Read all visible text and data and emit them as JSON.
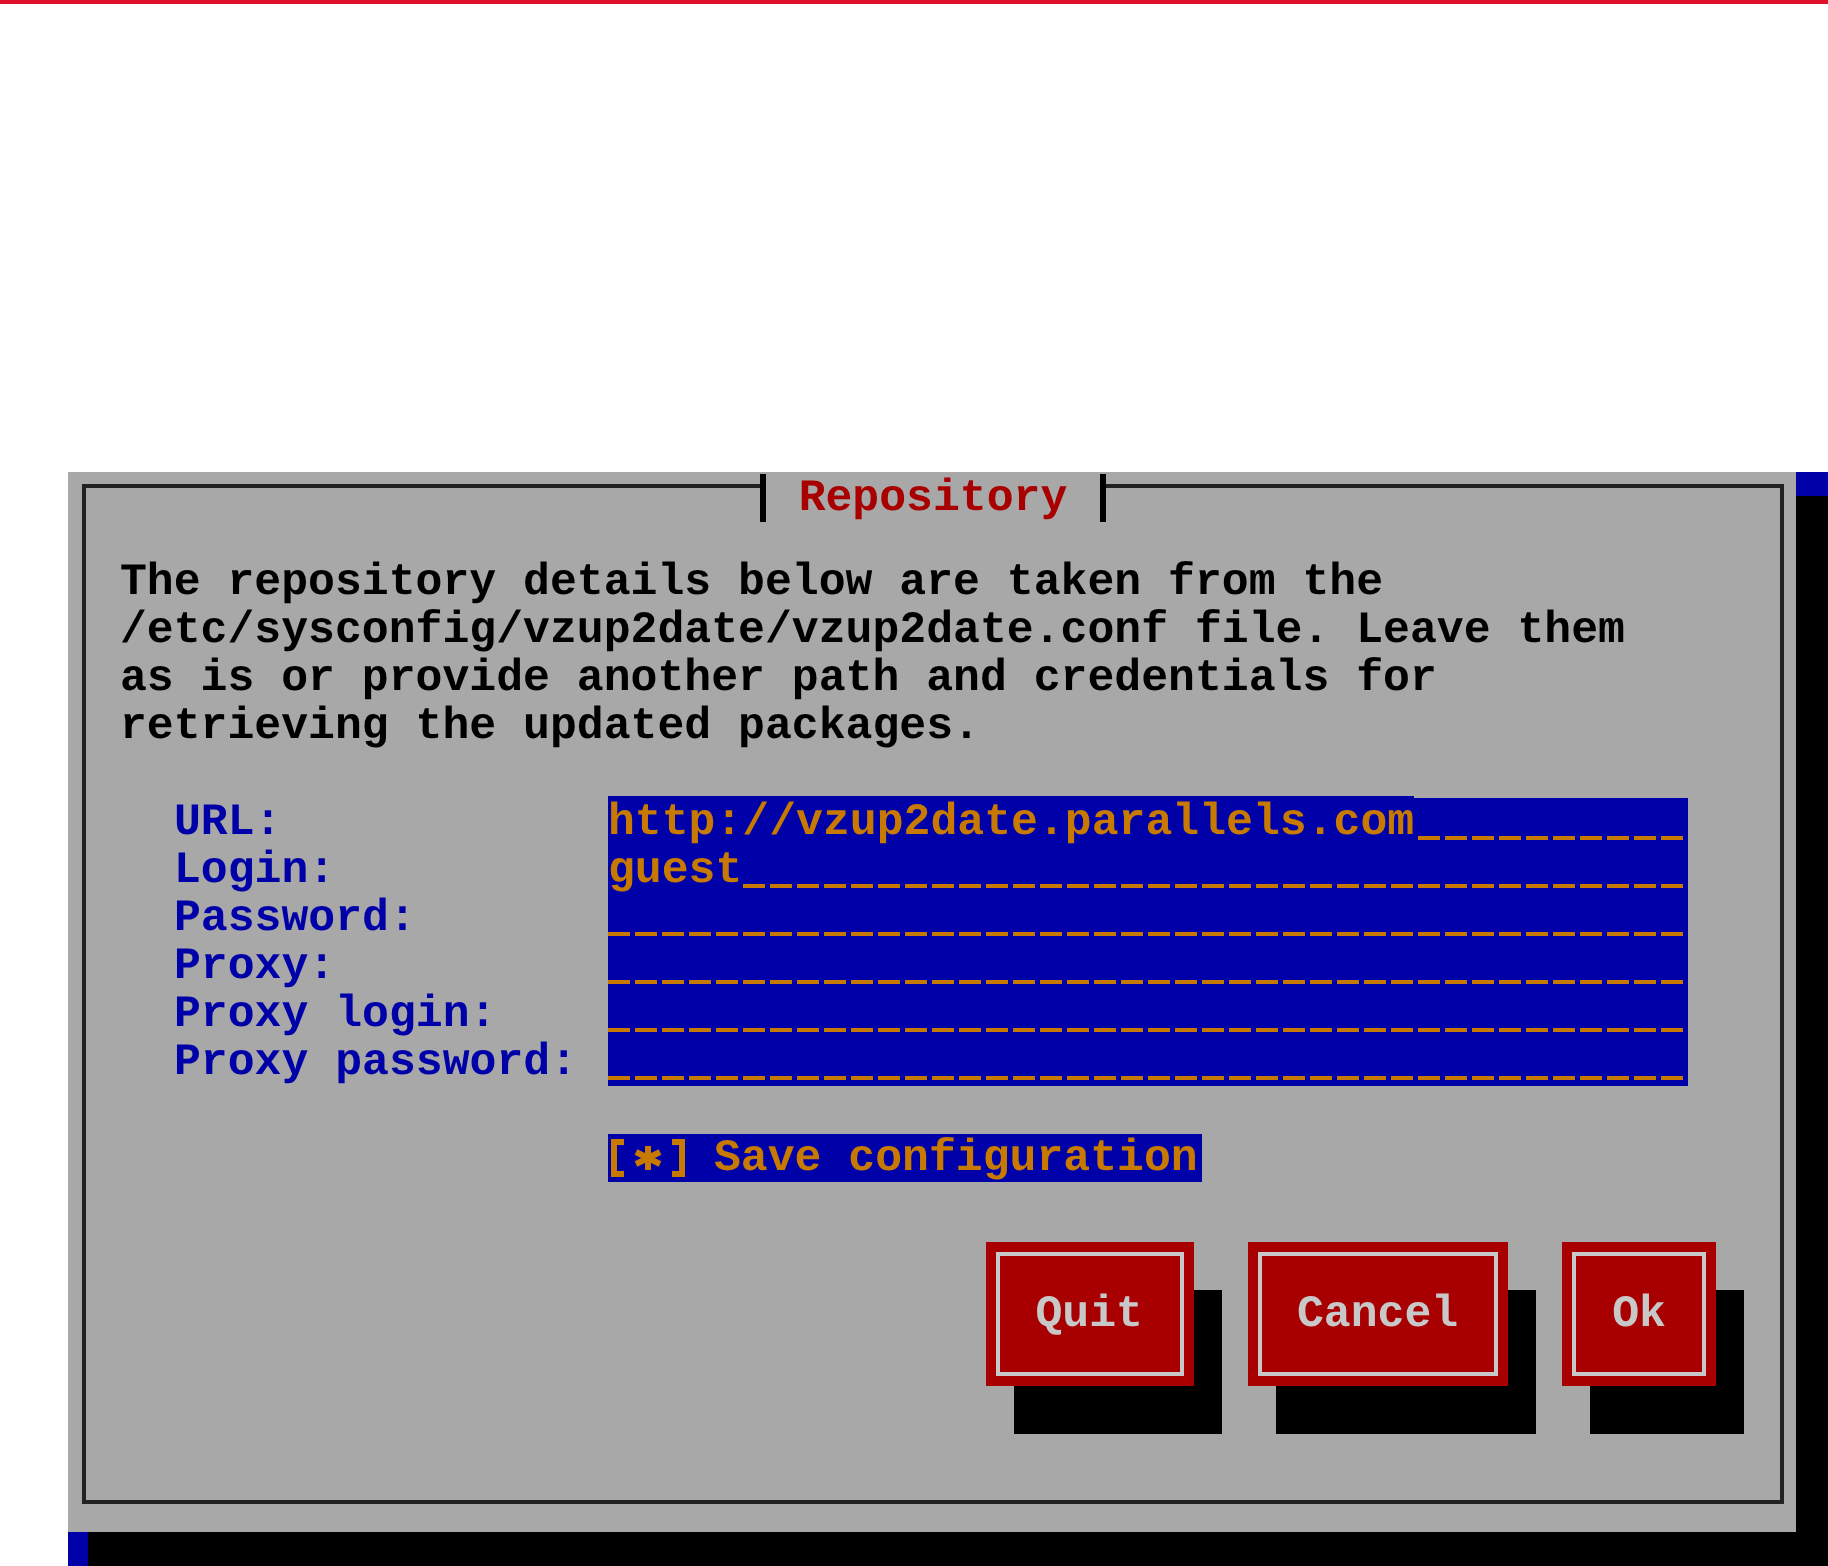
{
  "dialog": {
    "title": "Repository",
    "description": "The repository details below are taken from the /etc/sysconfig/vzup2date/vzup2date.conf file. Leave them as is or provide another path and credentials for retrieving the updated packages.",
    "fields": [
      {
        "label": "URL:",
        "value": "http://vzup2date.parallels.com"
      },
      {
        "label": "Login:",
        "value": "guest"
      },
      {
        "label": "Password:"
      },
      {
        "label": "Proxy:"
      },
      {
        "label": "Proxy login:"
      },
      {
        "label": "Proxy password:"
      }
    ],
    "checkbox": {
      "label": "Save configuration",
      "checked": true
    },
    "buttons": [
      "Quit",
      "Cancel",
      "Ok"
    ]
  }
}
